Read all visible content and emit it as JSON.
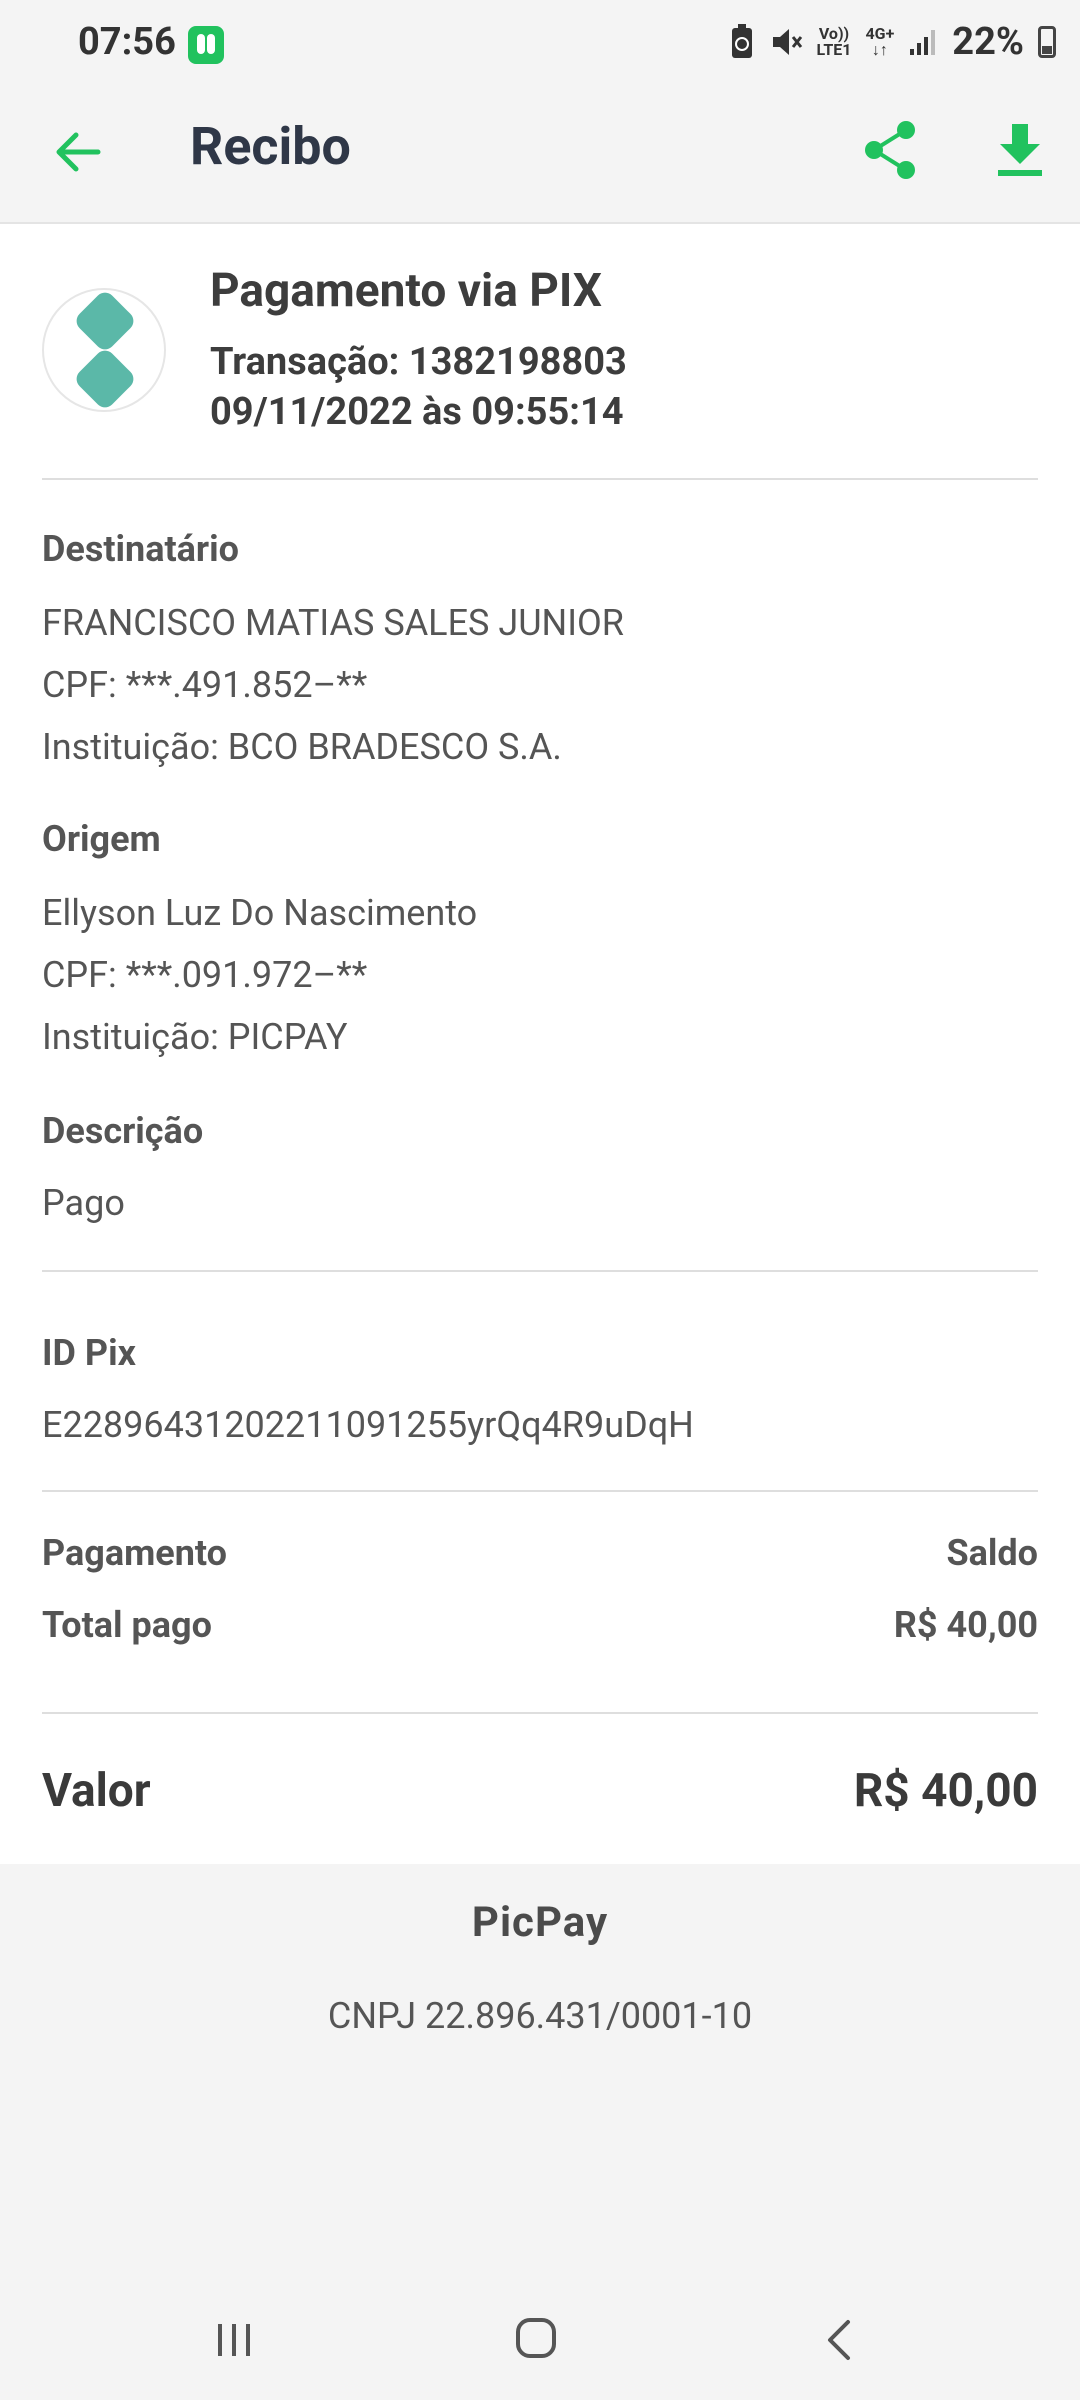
{
  "status_bar": {
    "time": "07:56",
    "battery": "22%",
    "network_top": "Vo))",
    "network_bottom": "LTE1",
    "data_type": "4G+"
  },
  "header": {
    "title": "Recibo"
  },
  "receipt": {
    "title": "Pagamento via PIX",
    "transaction": "Transação: 1382198803",
    "datetime": "09/11/2022 às 09:55:14",
    "recipient": {
      "label": "Destinatário",
      "name": "FRANCISCO MATIAS SALES JUNIOR",
      "cpf": "CPF: ***.491.852–**",
      "institution": "Instituição: BCO BRADESCO S.A."
    },
    "origin": {
      "label": "Origem",
      "name": "Ellyson Luz Do Nascimento",
      "cpf": "CPF: ***.091.972–**",
      "institution": "Instituição: PICPAY"
    },
    "description": {
      "label": "Descrição",
      "value": "Pago"
    },
    "pix_id": {
      "label": "ID Pix",
      "value": "E22896431202211091255yrQq4R9uDqH"
    },
    "payment": {
      "label": "Pagamento",
      "value": "Saldo"
    },
    "total_paid": {
      "label": "Total pago",
      "value": "R$ 40,00"
    },
    "amount": {
      "label": "Valor",
      "value": "R$ 40,00"
    }
  },
  "footer": {
    "brand": "PicPay",
    "cnpj": "CNPJ 22.896.431/0001-10"
  },
  "colors": {
    "accent": "#21c25e",
    "pix": "#5bb8a8"
  }
}
